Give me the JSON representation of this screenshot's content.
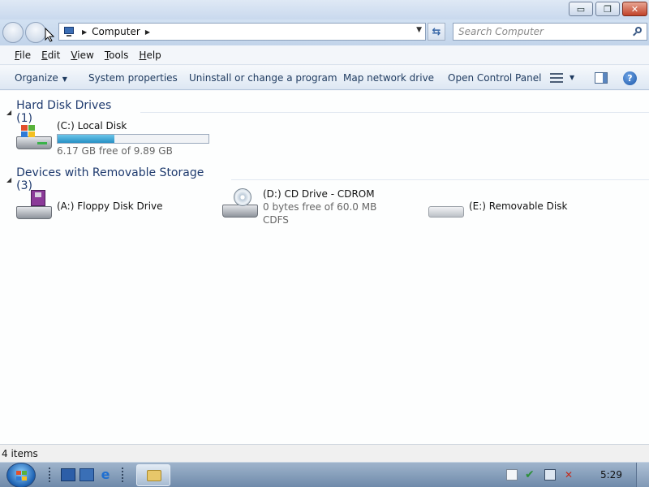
{
  "window": {
    "minimize_glyph": "▭",
    "maximize_glyph": "❐",
    "close_glyph": "✕"
  },
  "address": {
    "location_icon": "computer-icon",
    "location": "Computer",
    "search_placeholder": "Search Computer"
  },
  "menu": {
    "items": [
      "File",
      "Edit",
      "View",
      "Tools",
      "Help"
    ]
  },
  "toolbar": {
    "organize": "Organize",
    "system_properties": "System properties",
    "uninstall": "Uninstall or change a program",
    "map_network_drive": "Map network drive",
    "open_control_panel": "Open Control Panel",
    "help_glyph": "?"
  },
  "groups": {
    "hard_disks": {
      "title": "Hard Disk Drives (1)",
      "drives": [
        {
          "name": "(C:) Local Disk",
          "free_text": "6.17 GB free of 9.89 GB",
          "used_fraction": 0.376,
          "icon": "hard-disk-windows-icon"
        }
      ]
    },
    "removable": {
      "title": "Devices with Removable Storage (3)",
      "drives": [
        {
          "name": "(A:) Floppy Disk Drive",
          "icon": "floppy-drive-icon"
        },
        {
          "name": "(D:) CD Drive - CDROM",
          "free_text": "0 bytes free of 60.0 MB",
          "filesystem": "CDFS",
          "icon": "cd-drive-icon"
        },
        {
          "name": "(E:) Removable Disk",
          "icon": "removable-disk-icon"
        }
      ]
    }
  },
  "status": {
    "items_count": "4 items"
  },
  "taskbar": {
    "clock": "5:29"
  },
  "colors": {
    "usage_bar": "#2690c4",
    "group_header": "#1e3a6e",
    "toolbar_text": "#1e3a5f"
  }
}
